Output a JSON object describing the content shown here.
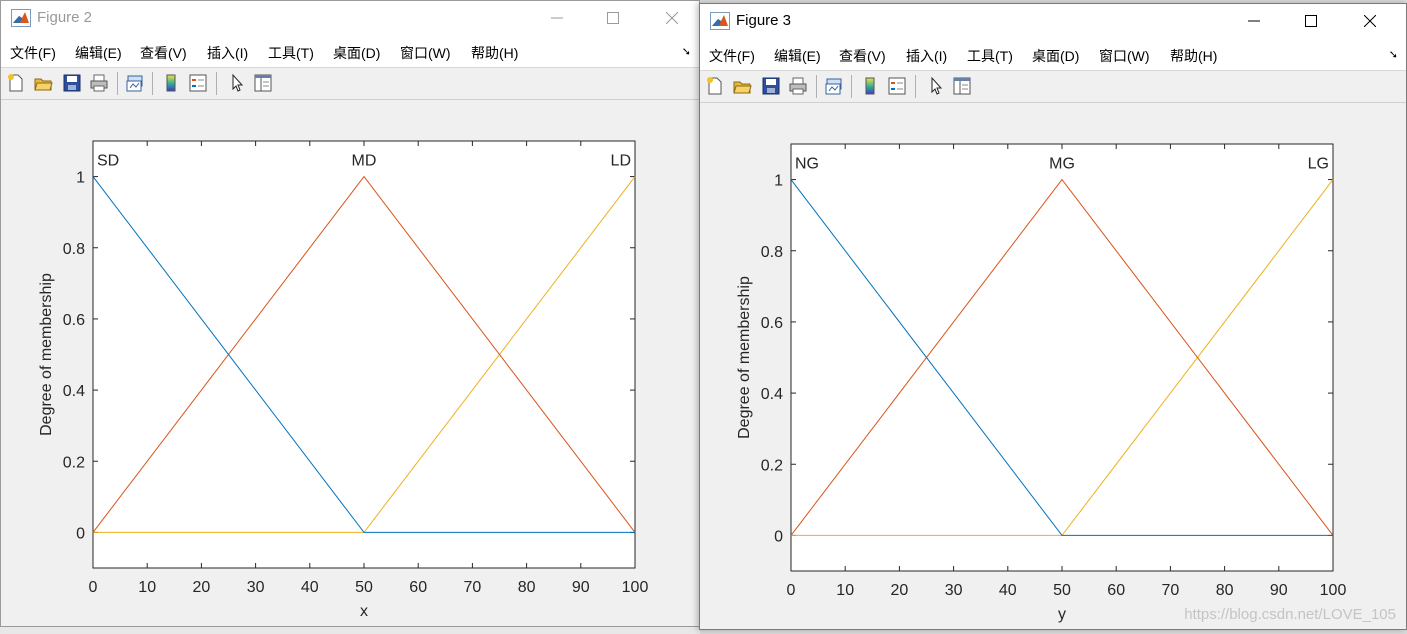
{
  "menu_labels": [
    "文件(F)",
    "编辑(E)",
    "查看(V)",
    "插入(I)",
    "工具(T)",
    "桌面(D)",
    "窗口(W)",
    "帮助(H)"
  ],
  "toolbar_icons": [
    "new-figure-icon",
    "open-file-icon",
    "save-icon",
    "print-icon",
    "link-plot-icon",
    "colorbar-icon",
    "legend-icon",
    "pointer-icon",
    "property-inspector-icon"
  ],
  "series_colors": [
    "#0072BD",
    "#D95319",
    "#EDB120"
  ],
  "windows": [
    {
      "title": "Figure 2",
      "active": false,
      "chart_data": {
        "type": "line",
        "xlabel": "x",
        "ylabel": "Degree of membership",
        "xlim": [
          0,
          100
        ],
        "ylim": [
          -0.1,
          1.1
        ],
        "xticks": [
          "0",
          "10",
          "20",
          "30",
          "40",
          "50",
          "60",
          "70",
          "80",
          "90",
          "100"
        ],
        "yticks": [
          "0",
          "0.2",
          "0.4",
          "0.6",
          "0.8",
          "1"
        ],
        "series": [
          {
            "name": "SD",
            "x": [
              0,
              50,
              100
            ],
            "y": [
              1,
              0,
              0
            ]
          },
          {
            "name": "MD",
            "x": [
              0,
              50,
              100
            ],
            "y": [
              0,
              1,
              0
            ]
          },
          {
            "name": "LD",
            "x": [
              0,
              50,
              100
            ],
            "y": [
              0,
              0,
              1
            ]
          }
        ]
      }
    },
    {
      "title": "Figure 3",
      "active": true,
      "chart_data": {
        "type": "line",
        "xlabel": "y",
        "ylabel": "Degree of membership",
        "xlim": [
          0,
          100
        ],
        "ylim": [
          -0.1,
          1.1
        ],
        "xticks": [
          "0",
          "10",
          "20",
          "30",
          "40",
          "50",
          "60",
          "70",
          "80",
          "90",
          "100"
        ],
        "yticks": [
          "0",
          "0.2",
          "0.4",
          "0.6",
          "0.8",
          "1"
        ],
        "series": [
          {
            "name": "NG",
            "x": [
              0,
              50,
              100
            ],
            "y": [
              1,
              0,
              0
            ]
          },
          {
            "name": "MG",
            "x": [
              0,
              50,
              100
            ],
            "y": [
              0,
              1,
              0
            ]
          },
          {
            "name": "LG",
            "x": [
              0,
              50,
              100
            ],
            "y": [
              0,
              0,
              1
            ]
          }
        ]
      }
    }
  ],
  "watermark": "https://blog.csdn.net/LOVE_105"
}
